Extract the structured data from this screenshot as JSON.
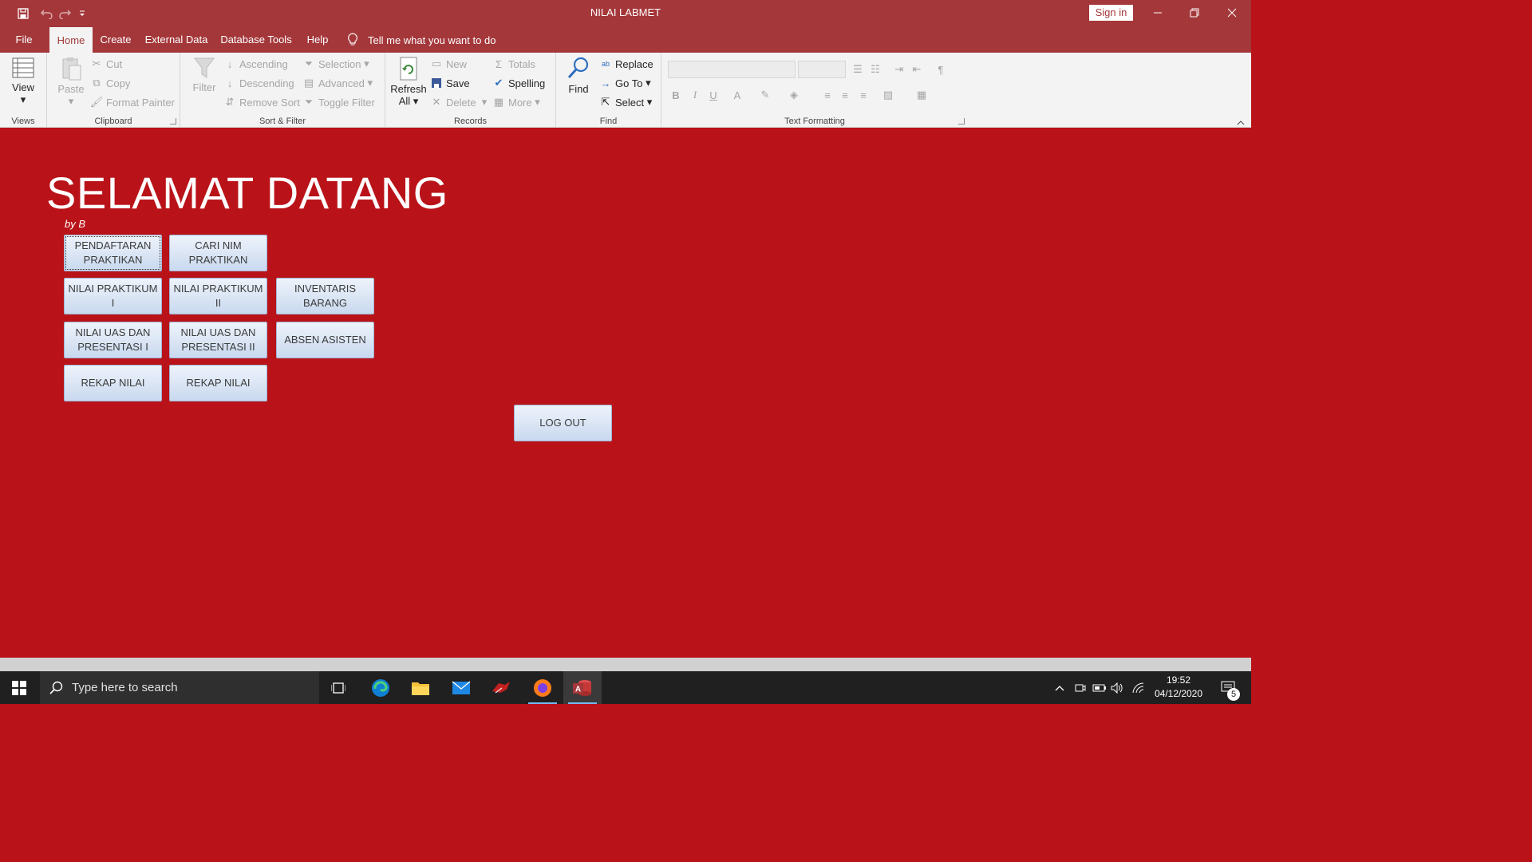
{
  "window": {
    "title": "NILAI LABMET",
    "sign_in": "Sign in"
  },
  "tabs": [
    {
      "label": "File"
    },
    {
      "label": "Home"
    },
    {
      "label": "Create"
    },
    {
      "label": "External Data"
    },
    {
      "label": "Database Tools"
    },
    {
      "label": "Help"
    }
  ],
  "tell_me": "Tell me what you want to do",
  "ribbon": {
    "views": {
      "view": "View",
      "label": "Views"
    },
    "clipboard": {
      "paste": "Paste",
      "cut": "Cut",
      "copy": "Copy",
      "format_painter": "Format Painter",
      "label": "Clipboard"
    },
    "sort_filter": {
      "filter": "Filter",
      "ascending": "Ascending",
      "descending": "Descending",
      "remove_sort": "Remove Sort",
      "selection": "Selection",
      "advanced": "Advanced",
      "toggle_filter": "Toggle Filter",
      "label": "Sort & Filter"
    },
    "records": {
      "refresh": "Refresh",
      "refresh_all": "All",
      "new": "New",
      "save": "Save",
      "delete": "Delete",
      "totals": "Totals",
      "spelling": "Spelling",
      "more": "More",
      "label": "Records"
    },
    "find": {
      "find": "Find",
      "replace": "Replace",
      "goto": "Go To",
      "select": "Select",
      "label": "Find"
    },
    "text_formatting": {
      "label": "Text Formatting",
      "bold": "B",
      "italic": "I",
      "underline": "U",
      "font_color": "A"
    }
  },
  "form": {
    "heading": "SELAMAT DATANG",
    "byline": "by B",
    "buttons": {
      "pendaftaran": "PENDAFTARAN PRAKTIKAN",
      "cari_nim": "CARI NIM PRAKTIKAN",
      "nilai_p1": "NILAI PRAKTIKUM I",
      "nilai_p2": "NILAI PRAKTIKUM II",
      "inventaris": "INVENTARIS BARANG",
      "uas1": "NILAI UAS DAN PRESENTASI I",
      "uas2": "NILAI UAS DAN PRESENTASI II",
      "absen": "ABSEN ASISTEN",
      "rekap1": "REKAP NILAI",
      "rekap2": "REKAP NILAI",
      "logout": "LOG OUT"
    }
  },
  "taskbar": {
    "search_placeholder": "Type here to search",
    "time": "19:52",
    "date": "04/12/2020",
    "notification_count": "5"
  },
  "colors": {
    "accent": "#a4373a",
    "form_bg": "#b91319",
    "button_top": "#eef3fb",
    "button_bottom": "#c9d9ef"
  },
  "icons": [
    "save-icon",
    "undo-icon",
    "redo-icon",
    "customize-icon",
    "minimize-icon",
    "restore-icon",
    "close-icon",
    "lightbulb-icon"
  ]
}
